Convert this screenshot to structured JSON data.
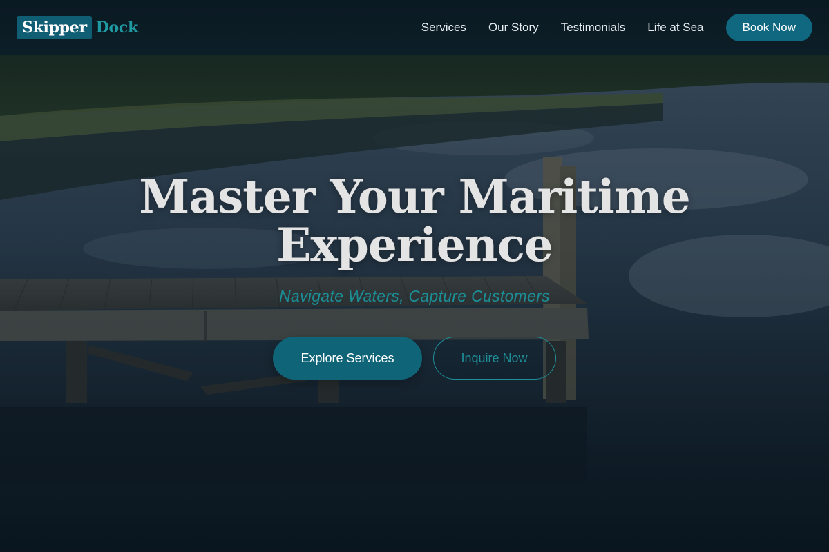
{
  "header": {
    "logo_part_1": "Skipper",
    "logo_part_2": "Dock",
    "nav": [
      {
        "label": "Services"
      },
      {
        "label": "Our Story"
      },
      {
        "label": "Testimonials"
      },
      {
        "label": "Life at Sea"
      }
    ],
    "cta_label": "Book Now"
  },
  "hero": {
    "title": "Master Your Maritime Experience",
    "subtitle": "Navigate Waters, Capture Customers",
    "primary_button": "Explore Services",
    "secondary_button": "Inquire Now"
  },
  "colors": {
    "brand_teal": "#0f6480",
    "accent_teal": "#1f9aa3",
    "header_bg": "#0c1e28",
    "title_text": "#e4e4e4"
  },
  "icons": {
    "background": "lake-dock-photo"
  }
}
